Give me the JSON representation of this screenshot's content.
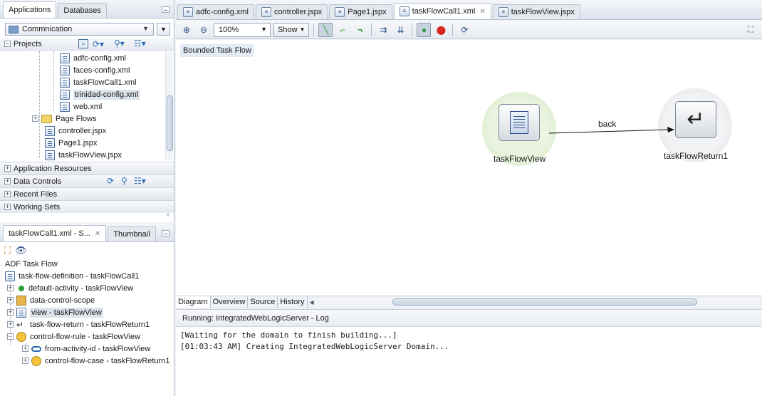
{
  "navigator": {
    "tabs": [
      "Applications",
      "Databases"
    ],
    "application": "Commnication",
    "projects_label": "Projects",
    "files": [
      {
        "name": "adfc-config.xml",
        "icon": "xml-file-icon"
      },
      {
        "name": "faces-config.xml",
        "icon": "xml-file-icon"
      },
      {
        "name": "taskFlowCall1.xml",
        "icon": "xml-file-icon"
      },
      {
        "name": "trinidad-config.xml",
        "icon": "xml-file-icon"
      },
      {
        "name": "web.xml",
        "icon": "xml-file-icon"
      }
    ],
    "page_flows": "Page Flows",
    "pages": [
      "controller.jspx",
      "Page1.jspx",
      "taskFlowView.jspx"
    ],
    "sections": [
      "Application Resources",
      "Data Controls",
      "Recent Files",
      "Working Sets"
    ]
  },
  "structure": {
    "tabs": [
      "taskFlowCall1.xml - S...",
      "Thumbnail"
    ],
    "root_label": "ADF Task Flow",
    "definition": "task-flow-definition - taskFlowCall1",
    "items": [
      "default-activity - taskFlowView",
      "data-control-scope",
      "view - taskFlowView",
      "task-flow-return - taskFlowReturn1",
      "control-flow-rule - taskFlowView"
    ],
    "children": [
      "from-activity-id - taskFlowView",
      "control-flow-case - taskFlowReturn1"
    ]
  },
  "editor": {
    "tabs": [
      "adfc-config.xml",
      "controller.jspx",
      "Page1.jspx",
      "taskFlowCall1.xml",
      "taskFlowView.jspx"
    ],
    "active_tab": "taskFlowCall1.xml",
    "zoom": "100%",
    "show_label": "Show",
    "canvas_label": "Bounded Task Flow",
    "nodes": {
      "view": "taskFlowView",
      "return": "taskFlowReturn1",
      "edge": "back"
    },
    "view_tabs": [
      "Diagram",
      "Overview",
      "Source",
      "History"
    ]
  },
  "log": {
    "title": "Running: IntegratedWebLogicServer - Log",
    "lines": [
      "[Waiting for the domain to finish building...]",
      "[01:03:43 AM] Creating IntegratedWebLogicServer Domain..."
    ]
  }
}
